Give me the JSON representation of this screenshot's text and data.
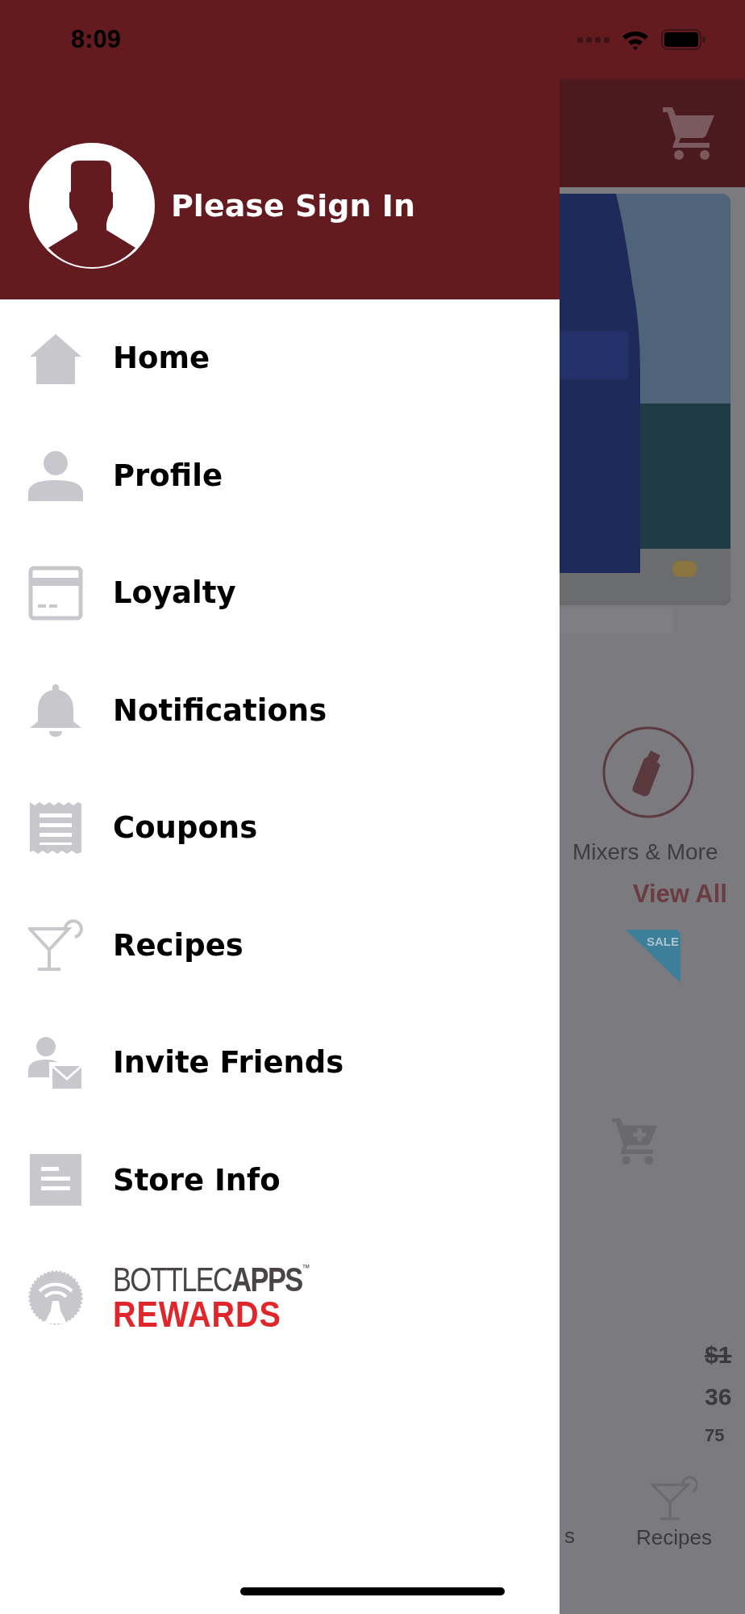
{
  "status_bar": {
    "time": "8:09"
  },
  "drawer": {
    "header": {
      "title": "Please Sign In"
    },
    "items": [
      {
        "label": "Home",
        "kind": "home"
      },
      {
        "label": "Profile",
        "kind": "profile"
      },
      {
        "label": "Loyalty",
        "kind": "loyalty"
      },
      {
        "label": "Notifications",
        "kind": "notifications"
      },
      {
        "label": "Coupons",
        "kind": "coupons"
      },
      {
        "label": "Recipes",
        "kind": "recipes"
      },
      {
        "label": "Invite Friends",
        "kind": "invite"
      },
      {
        "label": "Store Info",
        "kind": "store"
      }
    ],
    "rewards": {
      "line1": "BOTTLEC**APPS**$^{™}$",
      "line2": "REWARDS"
    }
  },
  "background": {
    "category": "Mixers & More",
    "view_all": "View All",
    "sale_tag": "SALE",
    "prices": [
      {
        "text": "$1",
        "kind": "old"
      },
      {
        "text": "36",
        "kind": "price"
      },
      {
        "text": "75",
        "kind": "size"
      }
    ],
    "tab_bar": [
      {
        "label": "s"
      },
      {
        "label": "Recipes"
      }
    ]
  }
}
